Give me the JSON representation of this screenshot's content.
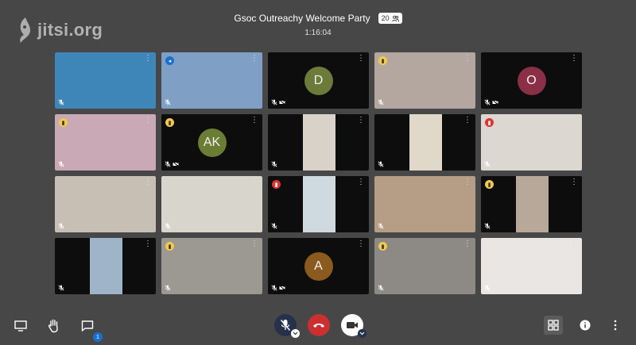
{
  "logo": {
    "text": "jitsi.org"
  },
  "header": {
    "title": "Gsoc Outreachy Welcome Party",
    "participant_count": "20",
    "timer": "1:16:04"
  },
  "tiles": [
    {
      "type": "video",
      "bg": "#3f86b8",
      "badge": ""
    },
    {
      "type": "video",
      "bg": "#7fa0c4",
      "badge": "blue",
      "active": true
    },
    {
      "type": "avatar",
      "initials": "D",
      "color": "#6c7b3a",
      "badge": ""
    },
    {
      "type": "video",
      "bg": "#b3a7a0",
      "badge": "yellow"
    },
    {
      "type": "avatar",
      "initials": "O",
      "color": "#8b2f47",
      "badge": ""
    },
    {
      "type": "video",
      "bg": "#c9a9b5",
      "badge": "yellow"
    },
    {
      "type": "avatar",
      "initials": "AK",
      "color": "#6b7d34",
      "badge": "yellow"
    },
    {
      "type": "video-narrow",
      "bg": "#d8d2c8",
      "badge": ""
    },
    {
      "type": "video-narrow",
      "bg": "#e0d8c8",
      "badge": ""
    },
    {
      "type": "video",
      "bg": "#dcd7d1",
      "badge": "red"
    },
    {
      "type": "video",
      "bg": "#c8bfb4",
      "badge": ""
    },
    {
      "type": "video",
      "bg": "#d8d5cc",
      "badge": ""
    },
    {
      "type": "video-narrow",
      "bg": "#cfd9e0",
      "badge": "red"
    },
    {
      "type": "video",
      "bg": "#b59d86",
      "badge": ""
    },
    {
      "type": "video-narrow",
      "bg": "#b8a89a",
      "badge": "yellow"
    },
    {
      "type": "video-narrow",
      "bg": "#9fb4c8",
      "badge": ""
    },
    {
      "type": "video",
      "bg": "#9c9892",
      "badge": "yellow"
    },
    {
      "type": "avatar",
      "initials": "A",
      "color": "#8a5a1e",
      "badge": ""
    },
    {
      "type": "video",
      "bg": "#8d8a86",
      "badge": "yellow"
    },
    {
      "type": "video",
      "bg": "#e9e6e4",
      "badge": ""
    }
  ],
  "toolbar": {
    "chat_unread": "1"
  },
  "colors": {
    "background": "#474747",
    "hangup": "#cc2f2f",
    "accent": "#1a6fd0"
  }
}
